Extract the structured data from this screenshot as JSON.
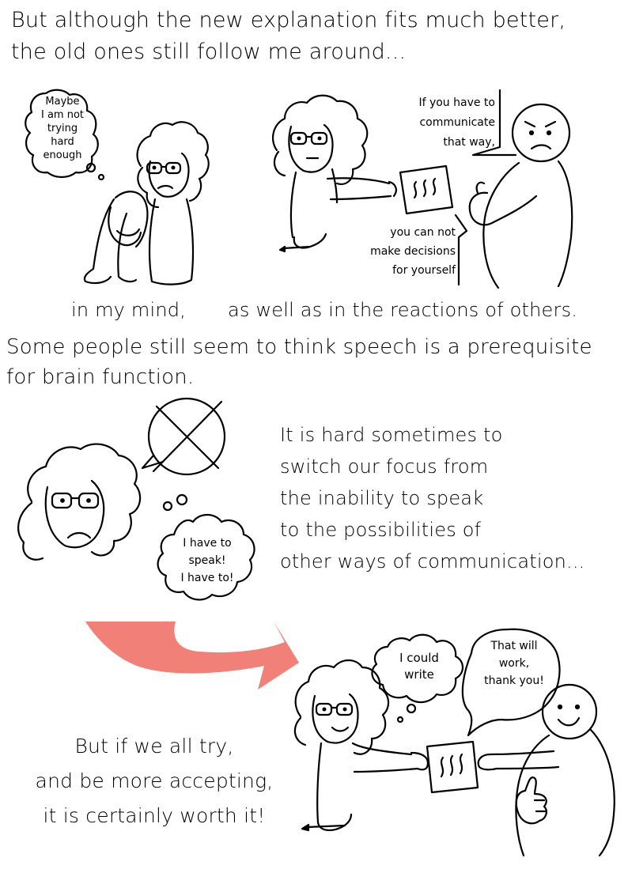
{
  "top_caption": {
    "lines": [
      "But although the new explanation fits much better,",
      "the old ones still follow me around..."
    ]
  },
  "panel1": {
    "thought": [
      "Maybe",
      "I am not",
      "trying",
      "hard",
      "enough"
    ],
    "caption": "in my mind,"
  },
  "panel2": {
    "speech_top": [
      "If you have to",
      "communicate",
      "that way,"
    ],
    "speech_bottom": [
      "you can not",
      "make decisions",
      "for yourself"
    ],
    "caption": "as well as in the reactions of others."
  },
  "middle_caption": {
    "lines": [
      "Some people still seem to think speech is a prerequisite",
      "for brain function."
    ]
  },
  "panel3": {
    "thought": [
      "I have to",
      "speak!",
      "I have to!"
    ],
    "side_text": [
      "It is hard sometimes to",
      "switch our focus from",
      "the inability to speak",
      "to the possibilities of",
      "other ways of communication..."
    ]
  },
  "panel4": {
    "arrow_color": "#f08078",
    "thought": [
      "I could",
      "write"
    ],
    "speech": [
      "That will",
      "work,",
      "thank you!"
    ],
    "caption": [
      "But if we all try,",
      "and be more accepting,",
      "it is certainly worth it!"
    ]
  }
}
